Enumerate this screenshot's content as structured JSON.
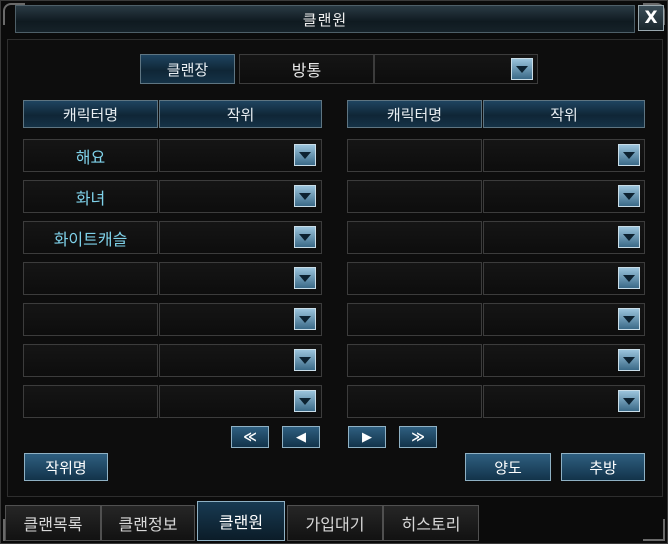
{
  "window": {
    "title": "클랜원",
    "close_label": "X"
  },
  "clan_leader": {
    "label": "클랜장",
    "name": "방통",
    "rank": ""
  },
  "columns": {
    "name_header": "캐릭터명",
    "rank_header": "작위"
  },
  "left_members": [
    {
      "name": "해요",
      "rank": ""
    },
    {
      "name": "화녀",
      "rank": ""
    },
    {
      "name": "화이트캐슬",
      "rank": ""
    },
    {
      "name": "",
      "rank": ""
    },
    {
      "name": "",
      "rank": ""
    },
    {
      "name": "",
      "rank": ""
    },
    {
      "name": "",
      "rank": ""
    }
  ],
  "right_members": [
    {
      "name": "",
      "rank": ""
    },
    {
      "name": "",
      "rank": ""
    },
    {
      "name": "",
      "rank": ""
    },
    {
      "name": "",
      "rank": ""
    },
    {
      "name": "",
      "rank": ""
    },
    {
      "name": "",
      "rank": ""
    },
    {
      "name": "",
      "rank": ""
    }
  ],
  "pager": {
    "first": "≪",
    "prev": "◀",
    "next": "▶",
    "last": "≫"
  },
  "buttons": {
    "rank_name": "작위명",
    "transfer": "양도",
    "expel": "추방"
  },
  "tabs": [
    {
      "label": "클랜목록",
      "active": false
    },
    {
      "label": "클랜정보",
      "active": false
    },
    {
      "label": "클랜원",
      "active": true
    },
    {
      "label": "가입대기",
      "active": false
    },
    {
      "label": "히스토리",
      "active": false
    }
  ],
  "colors": {
    "accent": "#1f4460",
    "member_name": "#7fd2ea"
  }
}
